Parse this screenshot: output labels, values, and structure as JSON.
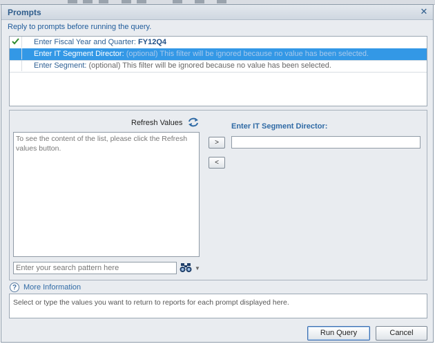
{
  "dialog": {
    "title": "Prompts",
    "instruction": "Reply to prompts before running the query."
  },
  "prompts": [
    {
      "label": "Enter Fiscal Year and Quarter:",
      "value": "FY12Q4",
      "note": "",
      "answered": true,
      "selected": false
    },
    {
      "label": "Enter IT Segment Director:",
      "value": "",
      "note": "(optional) This filter will be ignored because no value has been selected.",
      "answered": false,
      "selected": true
    },
    {
      "label": "Enter Segment:",
      "value": "",
      "note": "(optional) This filter will be ignored because no value has been selected.",
      "answered": false,
      "selected": false
    }
  ],
  "values_panel": {
    "refresh_label": "Refresh Values",
    "list_hint": "To see the content of the list, please click the Refresh values button.",
    "search_placeholder": "Enter your search pattern here",
    "add_label": ">",
    "remove_label": "<",
    "target_title": "Enter IT Segment Director:"
  },
  "more_info": {
    "label": "More Information",
    "text": "Select or type the values you want to return to reports for each prompt displayed here."
  },
  "buttons": {
    "run_query": "Run Query",
    "cancel": "Cancel"
  },
  "colors": {
    "selection": "#3398e6",
    "accent": "#2f6aa5",
    "check": "#2e8b2e"
  }
}
